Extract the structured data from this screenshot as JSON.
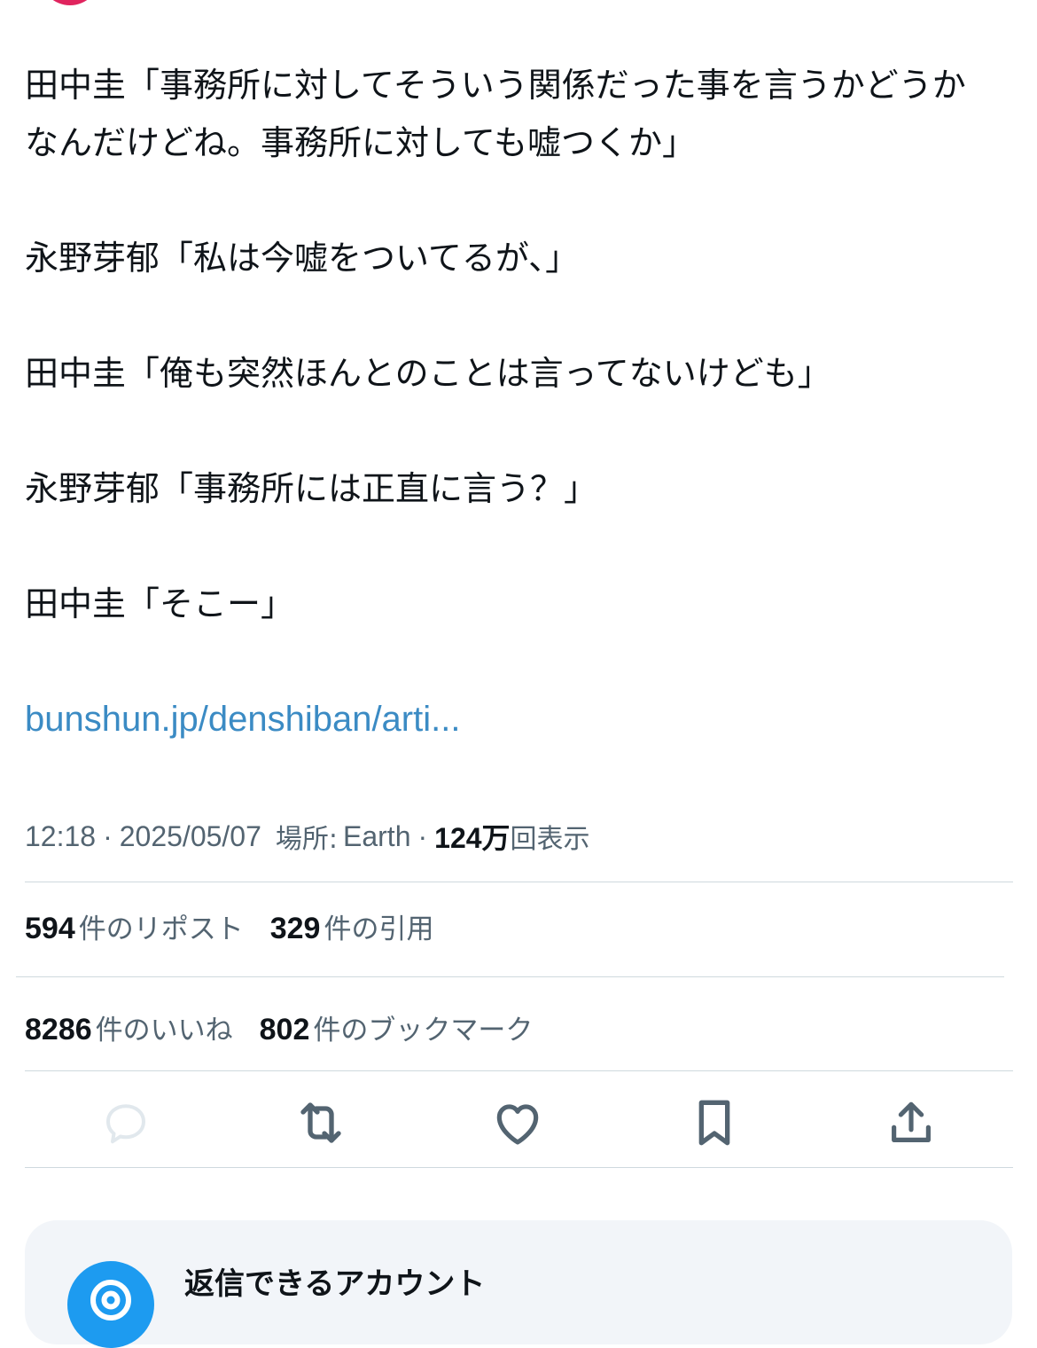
{
  "tweet": {
    "lines": [
      "田中圭「事務所に対してそういう関係だった事を言うかどうか",
      "なんだけどね。事務所に対しても嘘つくか」",
      "",
      "永野芽郁「私は今嘘をついてるが、」",
      "",
      "田中圭「俺も突然ほんとのことは言ってないけども」",
      "",
      "永野芽郁「事務所には正直に言う？」",
      "",
      "田中圭「そこー」"
    ],
    "link_text": "bunshun.jp/denshiban/arti..."
  },
  "meta": {
    "time": "12:18",
    "dot1": "·",
    "date": "2025/05/07",
    "location_label": "場所:",
    "location": "Earth",
    "dot2": "·",
    "views_num": "124万",
    "views_label": "回表示"
  },
  "stats": {
    "reposts_num": "594",
    "reposts_label": "件のリポスト",
    "quotes_num": "329",
    "quotes_label": "件の引用",
    "likes_num": "8286",
    "likes_label": "件のいいね",
    "bookmarks_num": "802",
    "bookmarks_label": "件のブックマーク"
  },
  "actions": {
    "reply_icon": "reply-icon",
    "repost_icon": "repost-icon",
    "like_icon": "heart-icon",
    "bookmark_icon": "bookmark-icon",
    "share_icon": "share-icon"
  },
  "reply_card": {
    "title": "返信できるアカウント"
  },
  "colors": {
    "text": "#0f1419",
    "secondary": "#536471",
    "link": "#3b8bc4",
    "divider": "#cfd9de",
    "card_bg": "#f2f5f9",
    "accent": "#1d9bf0"
  }
}
